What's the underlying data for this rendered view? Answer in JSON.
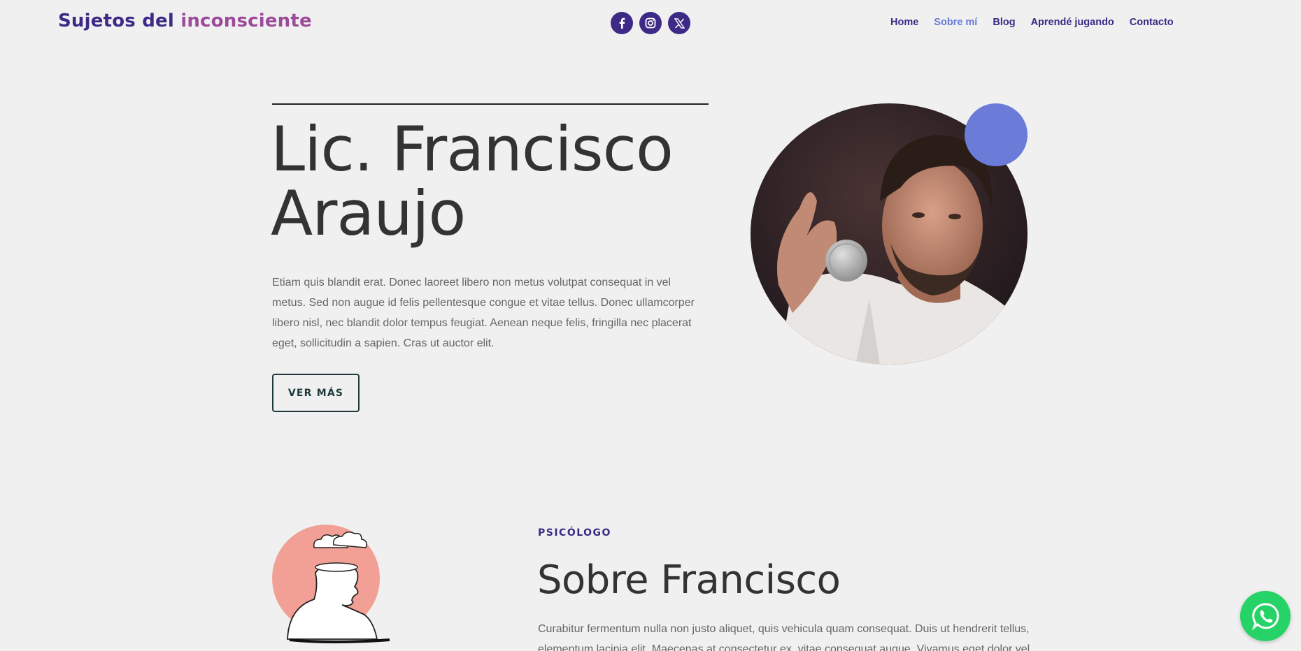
{
  "header": {
    "logo_part1": "Sujetos del",
    "logo_part2": "inconsciente",
    "social": [
      {
        "icon": "facebook-icon"
      },
      {
        "icon": "instagram-icon"
      },
      {
        "icon": "x-twitter-icon"
      }
    ],
    "nav": [
      {
        "label": "Home",
        "active": false
      },
      {
        "label": "Sobre mí",
        "active": true
      },
      {
        "label": "Blog",
        "active": false
      },
      {
        "label": "Aprendé jugando",
        "active": false
      },
      {
        "label": "Contacto",
        "active": false
      }
    ]
  },
  "hero": {
    "title_line1": "Lic. Francisco",
    "title_line2": "Araujo",
    "text": "Etiam quis blandit erat. Donec laoreet libero non metus volutpat consequat in vel metus. Sed non augue id felis pellentesque congue et vitae tellus. Donec ullamcorper libero nisl, nec blandit dolor tempus feugiat. Aenean neque felis, fringilla nec placerat eget, sollicitudin a sapien. Cras ut auctor elit.",
    "button_label": "VER MÁS"
  },
  "about": {
    "eyebrow": "PSICÓLOGO",
    "title": "Sobre Francisco",
    "text": "Curabitur fermentum nulla non justo aliquet, quis vehicula quam consequat. Duis ut hendrerit tellus, elementum lacinia elit. Maecenas at consectetur ex, vitae consequat augue. Vivamus eget dolor vel"
  },
  "colors": {
    "brand_primary": "#3c2a86",
    "brand_secondary": "#9b4b9a",
    "accent_blue": "#6a7bd8",
    "illustration_pink": "#f2a096",
    "whatsapp_green": "#25d366",
    "background": "#f0f0f0"
  },
  "floating": {
    "icon": "whatsapp-icon"
  }
}
